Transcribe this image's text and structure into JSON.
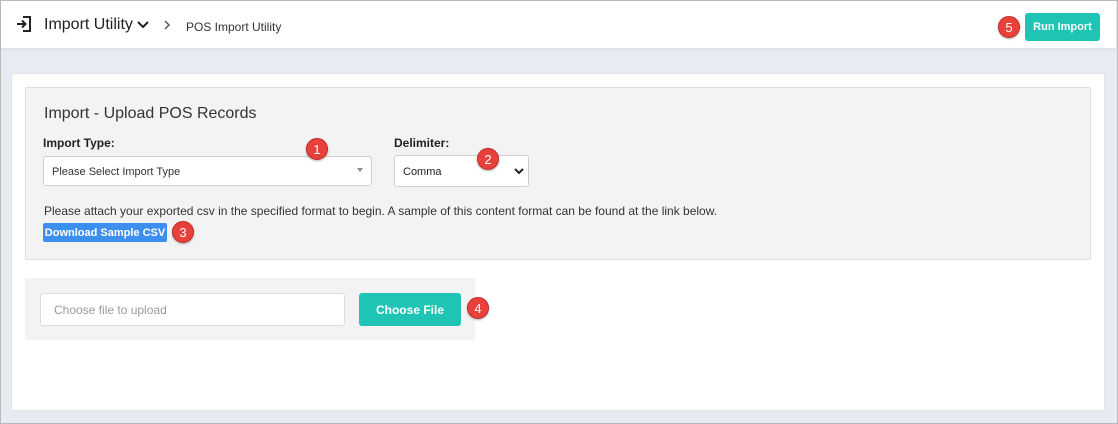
{
  "header": {
    "app_icon": "import-icon",
    "title": "Import Utility",
    "title_dropdown_icon": "chevron-down-icon",
    "breadcrumb_separator_icon": "chevron-right-icon",
    "breadcrumb": "POS Import Utility",
    "run_import_label": "Run Import"
  },
  "panel": {
    "title": "Import - Upload POS Records",
    "import_type_label": "Import Type:",
    "import_type_value": "Please Select Import Type",
    "delimiter_label": "Delimiter:",
    "delimiter_value": "Comma",
    "help_text": "Please attach your exported csv in the specified format to begin. A sample of this content format can be found at the link below.",
    "download_label": "Download Sample CSV"
  },
  "upload": {
    "placeholder": "Choose file to upload",
    "choose_label": "Choose File"
  },
  "markers": [
    "1",
    "2",
    "3",
    "4",
    "5"
  ],
  "colors": {
    "accent_teal": "#20c4b5",
    "link_blue": "#3d8fef",
    "marker_red": "#e8413c",
    "page_bg": "#e9ebf3"
  }
}
